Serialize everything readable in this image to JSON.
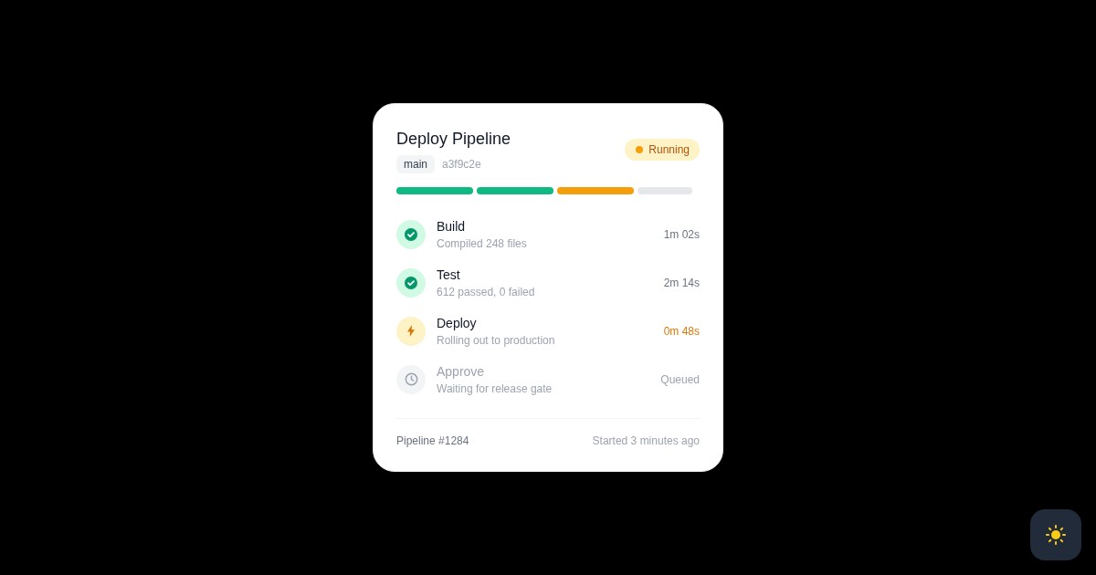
{
  "card": {
    "title": "Deploy Pipeline",
    "branch": "main",
    "commit": "a3f9c2e",
    "status": {
      "label": "Running",
      "kind": "running"
    },
    "steps": [
      {
        "kind": "done",
        "name": "Build",
        "detail": "Compiled 248 files",
        "time": "1m 02s"
      },
      {
        "kind": "done",
        "name": "Test",
        "detail": "612 passed, 0 failed",
        "time": "2m 14s"
      },
      {
        "kind": "running",
        "name": "Deploy",
        "detail": "Rolling out to production",
        "time": "0m 48s"
      },
      {
        "kind": "queued",
        "name": "Approve",
        "detail": "Waiting for release gate",
        "time": "Queued"
      }
    ],
    "footer": {
      "pipeline": "Pipeline #1284",
      "started": "Started 3 minutes ago"
    }
  }
}
